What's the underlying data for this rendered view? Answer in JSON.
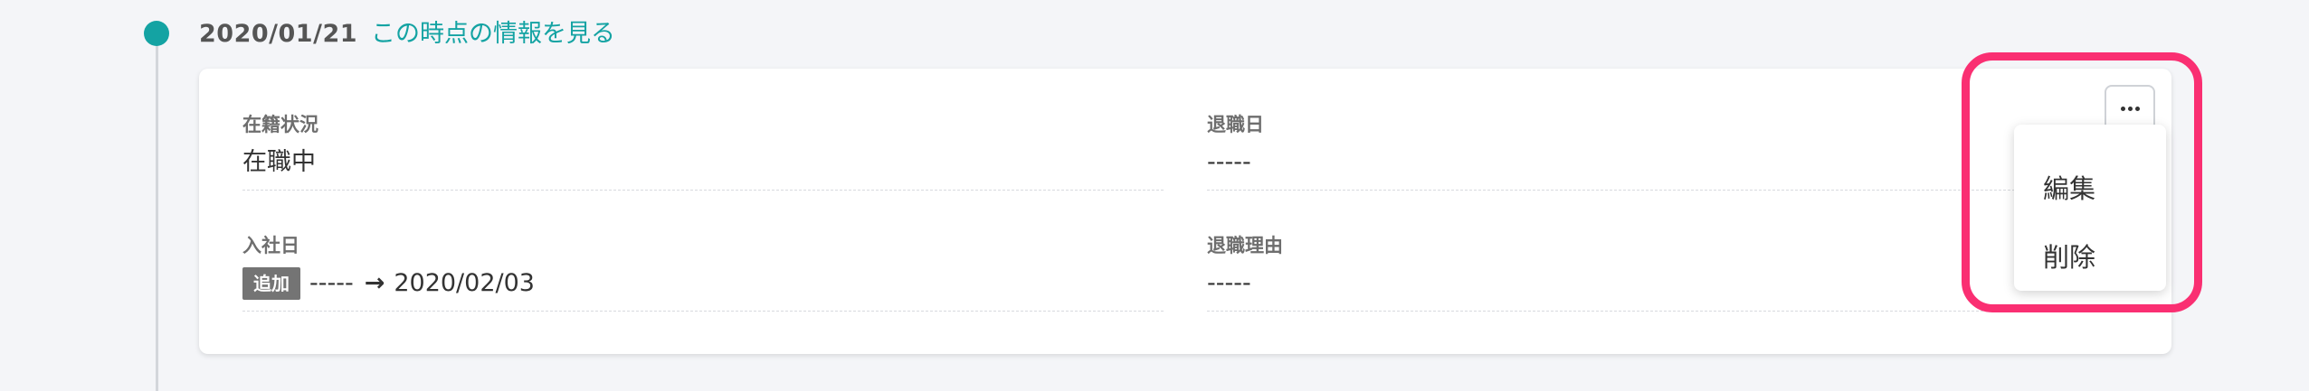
{
  "timeline": {
    "date": "2020/01/21",
    "link_label": "この時点の情報を見る"
  },
  "fields": {
    "employment_status": {
      "label": "在籍状況",
      "value": "在職中"
    },
    "retirement_date": {
      "label": "退職日",
      "value": "-----"
    },
    "hire_date": {
      "label": "入社日",
      "badge": "追加",
      "old_value": "-----",
      "arrow": "→",
      "new_value": "2020/02/03"
    },
    "retirement_reason": {
      "label": "退職理由",
      "value": "-----"
    }
  },
  "more_button": {
    "icon": "more-horizontal-icon"
  },
  "menu": {
    "items": [
      {
        "label": "編集"
      },
      {
        "label": "削除"
      }
    ]
  },
  "colors": {
    "accent": "#14a3a3",
    "highlight": "#fa2f72",
    "badge": "#747474"
  }
}
